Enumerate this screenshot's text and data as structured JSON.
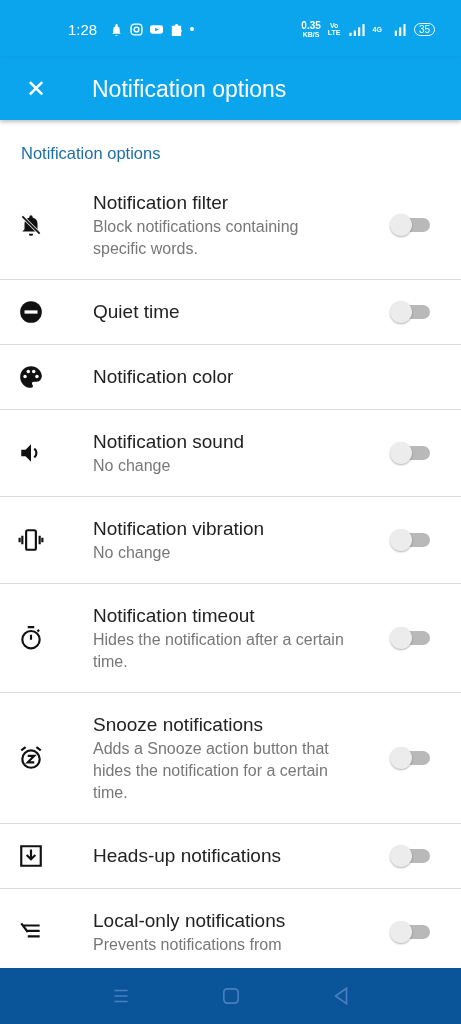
{
  "status_bar": {
    "time": "1:28",
    "speed": "0.35",
    "speed_unit": "KB/S",
    "volte_top": "Vo",
    "volte_bottom": "LTE",
    "network": "4G",
    "battery": "35"
  },
  "app_bar": {
    "close": "✕",
    "title": "Notification options"
  },
  "section": {
    "title": "Notification options"
  },
  "settings": [
    {
      "kind": "switch",
      "title": "Notification filter",
      "description": "Block notifications containing specific words.",
      "on": false
    },
    {
      "kind": "switch",
      "title": "Quiet time",
      "on": false
    },
    {
      "kind": "plain",
      "title": "Notification color"
    },
    {
      "kind": "switch",
      "title": "Notification sound",
      "description": "No change",
      "on": false
    },
    {
      "kind": "switch",
      "title": "Notification vibration",
      "description": "No change",
      "on": false
    },
    {
      "kind": "switch",
      "title": "Notification timeout",
      "description": "Hides the notification after a certain time.",
      "on": false
    },
    {
      "kind": "switch",
      "title": "Snooze notifications",
      "description": "Adds a Snooze action button that hides the notification for a certain time.",
      "on": false
    },
    {
      "kind": "switch",
      "title": "Heads-up notifications",
      "on": false
    },
    {
      "kind": "switch",
      "title": "Local-only notifications",
      "description": "Prevents notifications from",
      "on": false
    }
  ]
}
